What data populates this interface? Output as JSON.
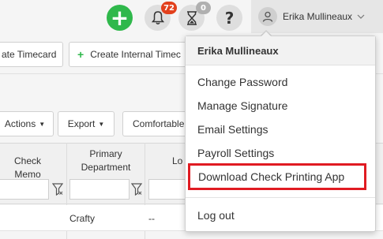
{
  "header": {
    "notifications_count": "72",
    "timers_count": "0",
    "help_label": "?",
    "user_name": "Erika Mullineaux"
  },
  "toolbar": {
    "create_timecard": "ate Timecard",
    "create_internal": "Create Internal Timec",
    "actions": "Actions",
    "export": "Export",
    "comfortable": "Comfortable"
  },
  "table": {
    "columns": [
      {
        "label": "Check Memo"
      },
      {
        "label_line1": "Primary",
        "label_line2": "Department"
      },
      {
        "label": "Lo"
      }
    ],
    "rows": [
      {
        "department": "Crafty",
        "location": "--"
      }
    ]
  },
  "user_menu": {
    "header": "Erika Mullineaux",
    "items": [
      "Change Password",
      "Manage Signature",
      "Email Settings",
      "Payroll Settings",
      "Download Check Printing App"
    ],
    "logout": "Log out"
  },
  "colors": {
    "add_button": "#2fb84b",
    "badge_red": "#e2401c",
    "highlight_border": "#e01b22"
  }
}
